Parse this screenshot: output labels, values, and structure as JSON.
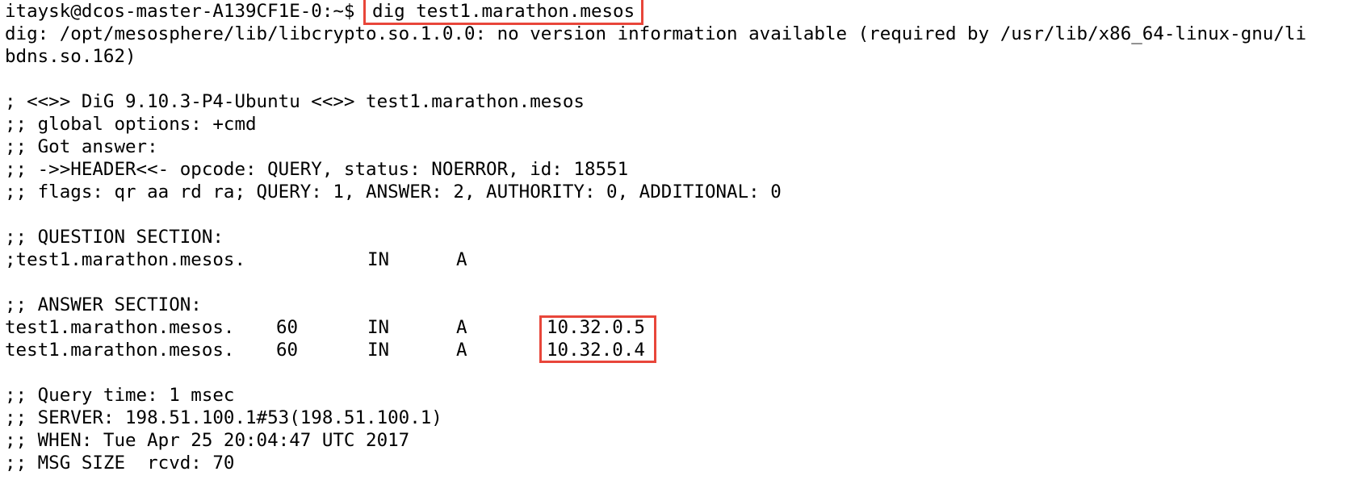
{
  "prompt": "itaysk@dcos-master-A139CF1E-0:~$ ",
  "command": "dig test1.marathon.mesos",
  "warning_line1": "dig: /opt/mesosphere/lib/libcrypto.so.1.0.0: no version information available (required by /usr/lib/x86_64-linux-gnu/li",
  "warning_line2": "bdns.so.162)",
  "header": {
    "banner": "; <<>> DiG 9.10.3-P4-Ubuntu <<>> test1.marathon.mesos",
    "global_options": ";; global options: +cmd",
    "got_answer": ";; Got answer:",
    "header_line": ";; ->>HEADER<<- opcode: QUERY, status: NOERROR, id: 18551",
    "flags_line": ";; flags: qr aa rd ra; QUERY: 1, ANSWER: 2, AUTHORITY: 0, ADDITIONAL: 0"
  },
  "question": {
    "title": ";; QUESTION SECTION:",
    "name": ";test1.marathon.mesos.",
    "class": "IN",
    "type": "A"
  },
  "answer": {
    "title": ";; ANSWER SECTION:",
    "records": [
      {
        "name": "test1.marathon.mesos.",
        "ttl": "60",
        "class": "IN",
        "type": "A",
        "address": "10.32.0.5"
      },
      {
        "name": "test1.marathon.mesos.",
        "ttl": "60",
        "class": "IN",
        "type": "A",
        "address": "10.32.0.4"
      }
    ]
  },
  "footer": {
    "query_time": ";; Query time: 1 msec",
    "server": ";; SERVER: 198.51.100.1#53(198.51.100.1)",
    "when": ";; WHEN: Tue Apr 25 20:04:47 UTC 2017",
    "msg_size": ";; MSG SIZE  rcvd: 70"
  },
  "colors": {
    "highlight": "#e8463a",
    "text": "#000000",
    "background": "#ffffff"
  }
}
